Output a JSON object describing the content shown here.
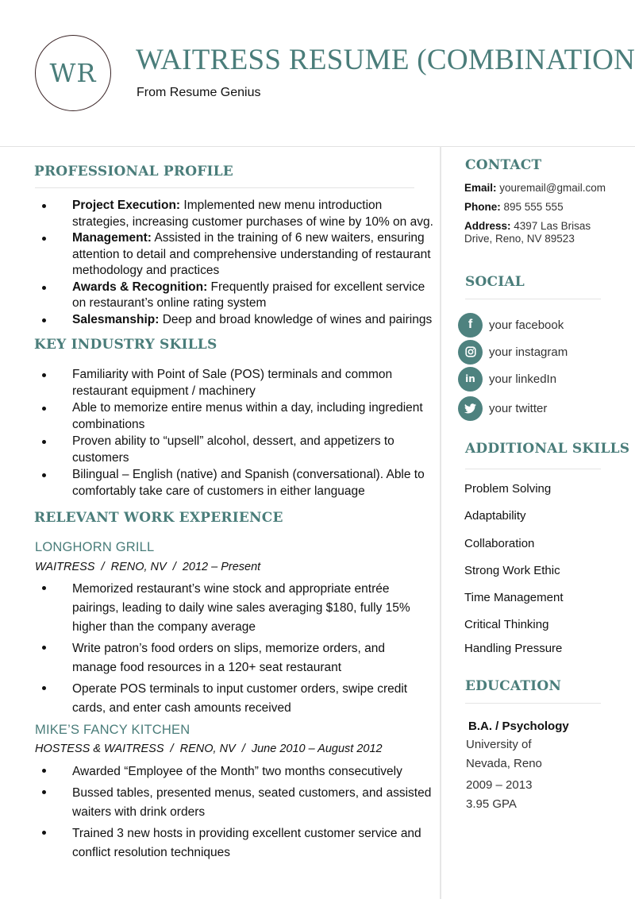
{
  "header": {
    "monogram": "WR",
    "title": "WAITRESS RESUME (COMBINATION)",
    "subtitle": "From Resume Genius"
  },
  "colors": {
    "accent": "#4a7d7a",
    "monogram_border": "#3a2426",
    "social_icon_bg": "#4e827f",
    "divider": "#e4e4e4"
  },
  "profile": {
    "heading": "PROFESSIONAL PROFILE",
    "items": [
      {
        "label": "Project Execution:",
        "text": " Implemented new menu introduction strategies, increasing customer purchases of wine by 10% on avg."
      },
      {
        "label": "Management:",
        "text": " Assisted in the training of 6 new waiters, ensuring attention to detail and comprehensive understanding of restaurant methodology and practices"
      },
      {
        "label": "Awards & Recognition:",
        "text": " Frequently praised for excellent service on restaurant’s online rating system"
      },
      {
        "label": "Salesmanship:",
        "text": " Deep and broad knowledge of wines and pairings"
      }
    ]
  },
  "skills": {
    "heading": "KEY INDUSTRY SKILLS",
    "items": [
      "Familiarity with Point of Sale (POS) terminals and common restaurant equipment / machinery",
      "Able to memorize entire menus within a day, including ingredient combinations",
      "Proven ability to “upsell” alcohol, dessert, and appetizers to customers",
      "Bilingual – English (native) and Spanish (conversational). Able to comfortably take care of customers in either language"
    ]
  },
  "experience": {
    "heading": "RELEVANT WORK EXPERIENCE",
    "jobs": [
      {
        "company": "LONGHORN GRILL",
        "meta": "WAITRESS  /  RENO, NV  /  2012 – Present",
        "bullets": [
          "Memorized restaurant’s wine stock and appropriate entrée pairings, leading to daily wine sales averaging $180, fully 15% higher than the company average",
          "Write patron’s food orders on slips, memorize orders, and manage food resources in a 120+ seat restaurant",
          "Operate POS terminals to input customer orders, swipe credit cards, and enter cash amounts received"
        ]
      },
      {
        "company": "MIKE’S FANCY KITCHEN",
        "meta": "HOSTESS & WAITRESS  /  RENO, NV  /  June 2010 – August 2012",
        "bullets": [
          "Awarded “Employee of the Month” two months consecutively",
          "Bussed tables, presented menus, seated customers, and assisted waiters with drink orders",
          "Trained 3 new hosts in providing excellent customer service and conflict resolution techniques"
        ]
      }
    ]
  },
  "contact": {
    "heading": "CONTACT",
    "email_label": "Email:",
    "email": " youremail@gmail.com",
    "phone_label": "Phone:",
    "phone": " 895 555 555",
    "address_label": "Address:",
    "address": " 4397 Las Brisas Drive, Reno, NV 89523"
  },
  "social": {
    "heading": "SOCIAL",
    "items": [
      {
        "icon": "facebook-icon",
        "glyph": "f",
        "label": "your facebook"
      },
      {
        "icon": "instagram-icon",
        "glyph": "◎",
        "label": "your instagram"
      },
      {
        "icon": "linkedin-icon",
        "glyph": "in",
        "label": "your linkedIn"
      },
      {
        "icon": "twitter-icon",
        "glyph": "🐦",
        "label": "your twitter"
      }
    ]
  },
  "additional_skills": {
    "heading": "ADDITIONAL SKILLS",
    "items": [
      "Problem Solving",
      "Adaptability",
      "Collaboration",
      "Strong Work Ethic",
      "Time Management",
      "Critical Thinking",
      "Handling Pressure"
    ]
  },
  "education": {
    "heading": "EDUCATION",
    "degree": "B.A. / Psychology",
    "school_line1": "University of",
    "school_line2": "Nevada, Reno",
    "years": "2009 – 2013",
    "gpa": "3.95 GPA"
  }
}
